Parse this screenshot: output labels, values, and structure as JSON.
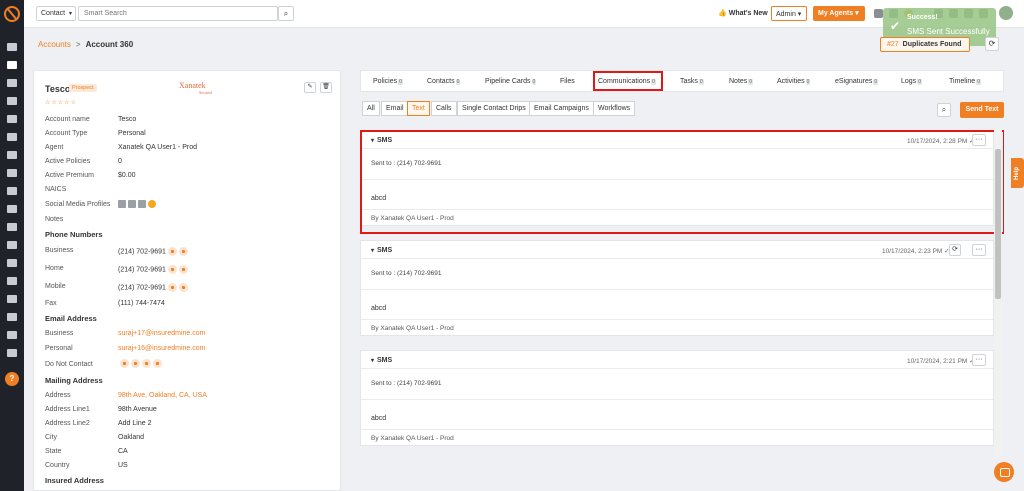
{
  "topbar": {
    "search_type": "Contact",
    "search_placeholder": "Smart Search",
    "whats_new": "What's New",
    "admin": "Admin",
    "my_agents": "My Agents"
  },
  "toast": {
    "title": "Success!",
    "message": "SMS Sent Successfully"
  },
  "breadcrumb": {
    "parent": "Accounts",
    "separator": ">",
    "current": "Account 360"
  },
  "duplicates": {
    "count": "#27",
    "label": "Duplicates Found"
  },
  "account": {
    "name": "Tesco",
    "badge": "Prospect",
    "stars": "☆☆☆☆☆",
    "agency_logo": "Xanatek",
    "agency_sub": "Secured",
    "fields": [
      {
        "label": "Account name",
        "value": "Tesco"
      },
      {
        "label": "Account Type",
        "value": "Personal"
      },
      {
        "label": "Agent",
        "value": "Xanatek QA User1 - Prod"
      },
      {
        "label": "Active Policies",
        "value": "0"
      },
      {
        "label": "Active Premium",
        "value": "$0.00"
      },
      {
        "label": "NAICS",
        "value": ""
      },
      {
        "label": "Social Media Profiles",
        "value": ""
      },
      {
        "label": "Notes",
        "value": ""
      }
    ],
    "phone_section": "Phone Numbers",
    "phones": [
      {
        "label": "Business",
        "value": "(214) 702-9691"
      },
      {
        "label": "Home",
        "value": "(214) 702-9691"
      },
      {
        "label": "Mobile",
        "value": "(214) 702-9691"
      },
      {
        "label": "Fax",
        "value": "(111) 744-7474"
      }
    ],
    "email_section": "Email Address",
    "emails": [
      {
        "label": "Business",
        "value": "suraj+17@insuredmine.com"
      },
      {
        "label": "Personal",
        "value": "suraj+16@insuredmine.com"
      },
      {
        "label": "Do Not Contact",
        "value": ""
      }
    ],
    "mailing_section": "Mailing Address",
    "mailing": [
      {
        "label": "Address",
        "value": "98th Ave, Oakland, CA, USA"
      },
      {
        "label": "Address Line1",
        "value": "98th Avenue"
      },
      {
        "label": "Address Line2",
        "value": "Add Line 2"
      },
      {
        "label": "City",
        "value": "Oakland"
      },
      {
        "label": "State",
        "value": "CA"
      },
      {
        "label": "Country",
        "value": "US"
      }
    ],
    "insured_section": "Insured Address"
  },
  "tabs": [
    {
      "label": "Policies",
      "count": "0"
    },
    {
      "label": "Contacts",
      "count": "0"
    },
    {
      "label": "Pipeline Cards",
      "count": "0"
    },
    {
      "label": "Files",
      "count": ""
    },
    {
      "label": "Communications",
      "count": "0"
    },
    {
      "label": "Tasks",
      "count": "0"
    },
    {
      "label": "Notes",
      "count": "0"
    },
    {
      "label": "Activities",
      "count": "0"
    },
    {
      "label": "eSignatures",
      "count": "0"
    },
    {
      "label": "Logs",
      "count": "0"
    },
    {
      "label": "Timeline",
      "count": "0"
    }
  ],
  "subtabs": [
    "All",
    "Email",
    "Text",
    "Calls",
    "Single Contact Drips",
    "Email Campaigns",
    "Workflows"
  ],
  "send_text": "Send Text",
  "messages": [
    {
      "type": "SMS",
      "timestamp": "10/17/2024, 2:28 PM",
      "check": "✓",
      "to": "Sent to : (214) 702-9691",
      "body": "abcd",
      "by": "By Xanatek QA User1 - Prod"
    },
    {
      "type": "SMS",
      "timestamp": "10/17/2024, 2:23 PM",
      "check": "✓",
      "to": "Sent to : (214) 702-9691",
      "body": "abcd",
      "by": "By Xanatek QA User1 - Prod"
    },
    {
      "type": "SMS",
      "timestamp": "10/17/2024, 2:21 PM",
      "check": "✓",
      "to": "Sent to : (214) 702-9691",
      "body": "abcd",
      "by": "By Xanatek QA User1 - Prod"
    }
  ],
  "help_label": "Help",
  "colors": {
    "accent": "#f07f24",
    "highlight": "#e01818",
    "sidebar": "#1f2329"
  }
}
